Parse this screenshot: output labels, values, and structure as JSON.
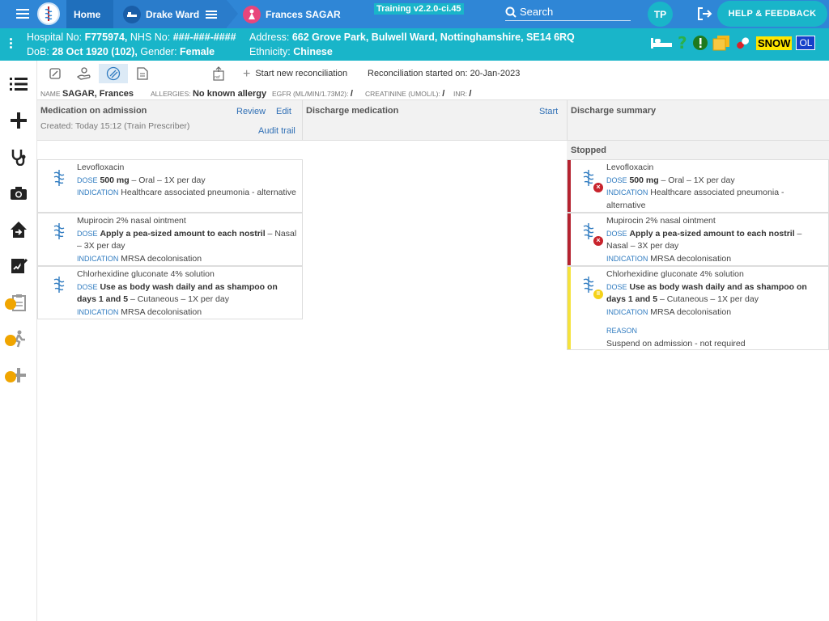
{
  "header": {
    "home_label": "Home",
    "ward_label": "Drake Ward",
    "patient_label": "Frances SAGAR",
    "training_badge": "Training v2.2.0-ci.45",
    "search_label": "Search",
    "avatar_initials": "TP",
    "help_label": "HELP & FEEDBACK"
  },
  "patient": {
    "hospital_no_label": "Hospital No:",
    "hospital_no": "F775974,",
    "nhs_no_label": "NHS No:",
    "nhs_no": "###-###-####",
    "dob_label": "DoB:",
    "dob": "28 Oct 1920 (102),",
    "gender_label": "Gender:",
    "gender": "Female",
    "address_label": "Address:",
    "address": "662 Grove Park, Bulwell Ward, Nottinghamshire, SE14 6RQ",
    "ethnicity_label": "Ethnicity:",
    "ethnicity": "Chinese",
    "snow_badge": "SNOW",
    "ol_badge": "OL"
  },
  "toolbar": {
    "start_new_label": "Start new reconciliation",
    "started_on": "Reconciliation started on: 20-Jan-2023"
  },
  "info": {
    "name_label": "NAME",
    "name": "SAGAR, Frances",
    "allergies_label": "ALLERGIES:",
    "allergies": "No known allergy",
    "egfr_label": "EGFR (ML/MIN/1.73M2):",
    "egfr": "/",
    "creatinine_label": "CREATININE (UMOL/L):",
    "creatinine": "/",
    "inr_label": "INR:",
    "inr": "/"
  },
  "columns": {
    "admission": {
      "title": "Medication on admission",
      "review": "Review",
      "edit": "Edit",
      "created": "Created: Today 15:12 (Train Prescriber)",
      "audit": "Audit trail"
    },
    "discharge": {
      "title": "Discharge medication",
      "start": "Start"
    },
    "summary": {
      "title": "Discharge summary",
      "stopped": "Stopped"
    }
  },
  "medications": [
    {
      "name": "Levofloxacin",
      "dose_label": "DOSE",
      "dose": "500 mg",
      "route": " – Oral – 1X per day",
      "indication_label": "INDICATION",
      "indication": "Healthcare associated pneumonia - alternative"
    },
    {
      "name": "Mupirocin 2% nasal ointment",
      "dose_label": "DOSE",
      "dose": "Apply a pea-sized amount to each nostril",
      "route": " – Nasal – 3X per day",
      "indication_label": "INDICATION",
      "indication": "MRSA decolonisation"
    },
    {
      "name": "Chlorhexidine gluconate 4% solution",
      "dose_label": "DOSE",
      "dose": "Use as body wash daily and as shampoo on days 1 and 5",
      "route": " – Cutaneous – 1X per day",
      "indication_label": "INDICATION",
      "indication": "MRSA decolonisation",
      "reason_label": "REASON",
      "reason": "Suspend on admission - not required"
    }
  ],
  "colors": {
    "stopped": "#b5222f",
    "suspended": "#f5e23c",
    "accent": "#19b5c9",
    "nav": "#2f86d6"
  }
}
